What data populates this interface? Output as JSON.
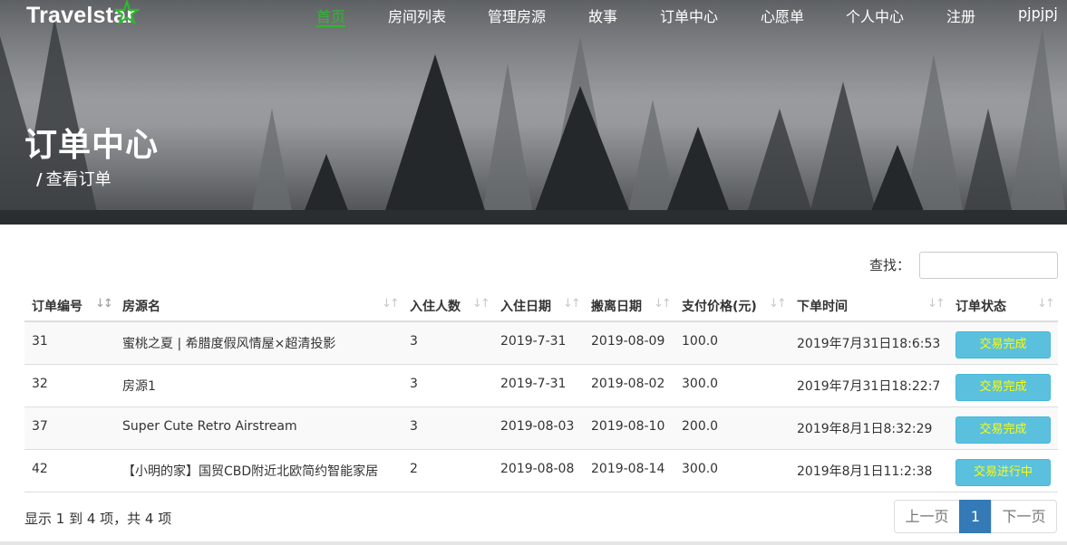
{
  "nav": {
    "logo": "Travelstar",
    "items": [
      {
        "label": "首页",
        "active": true
      },
      {
        "label": "房间列表"
      },
      {
        "label": "管理房源"
      },
      {
        "label": "故事"
      },
      {
        "label": "订单中心"
      },
      {
        "label": "心愿单"
      },
      {
        "label": "个人中心"
      },
      {
        "label": "注册"
      },
      {
        "label": "pjpjpj"
      }
    ]
  },
  "hero": {
    "title": "订单中心",
    "breadcrumb_sep": "/",
    "breadcrumb": "查看订单"
  },
  "search": {
    "label": "查找：",
    "value": "",
    "placeholder": ""
  },
  "table": {
    "columns": [
      "订单编号",
      "房源名",
      "入住人数",
      "入住日期",
      "搬离日期",
      "支付价格(元)",
      "下单时间",
      "订单状态"
    ],
    "sorted_column": "订单编号",
    "rows": [
      {
        "id": "31",
        "name": "蜜桃之夏 | 希腊度假风情屋×超清投影",
        "guests": "3",
        "checkin": "2019-7-31",
        "checkout": "2019-08-09",
        "price": "100.0",
        "ordered": "2019年7月31日18:6:53",
        "status": "交易完成"
      },
      {
        "id": "32",
        "name": "房源1",
        "guests": "3",
        "checkin": "2019-7-31",
        "checkout": "2019-08-02",
        "price": "300.0",
        "ordered": "2019年7月31日18:22:7",
        "status": "交易完成"
      },
      {
        "id": "37",
        "name": "Super Cute Retro Airstream",
        "guests": "3",
        "checkin": "2019-08-03",
        "checkout": "2019-08-10",
        "price": "200.0",
        "ordered": "2019年8月1日8:32:29",
        "status": "交易完成"
      },
      {
        "id": "42",
        "name": "【小明的家】国贸CBD附近北欧简约智能家居",
        "guests": "2",
        "checkin": "2019-08-08",
        "checkout": "2019-08-14",
        "price": "300.0",
        "ordered": "2019年8月1日11:2:38",
        "status": "交易进行中"
      }
    ]
  },
  "footer": {
    "info": "显示 1 到 4 项，共 4 项",
    "prev": "上一页",
    "current_page": "1",
    "next": "下一页"
  },
  "colors": {
    "nav_active": "#2eb82e",
    "status_button": "#5bc0de",
    "status_text": "#fffb00",
    "pager_active": "#337ab7"
  }
}
